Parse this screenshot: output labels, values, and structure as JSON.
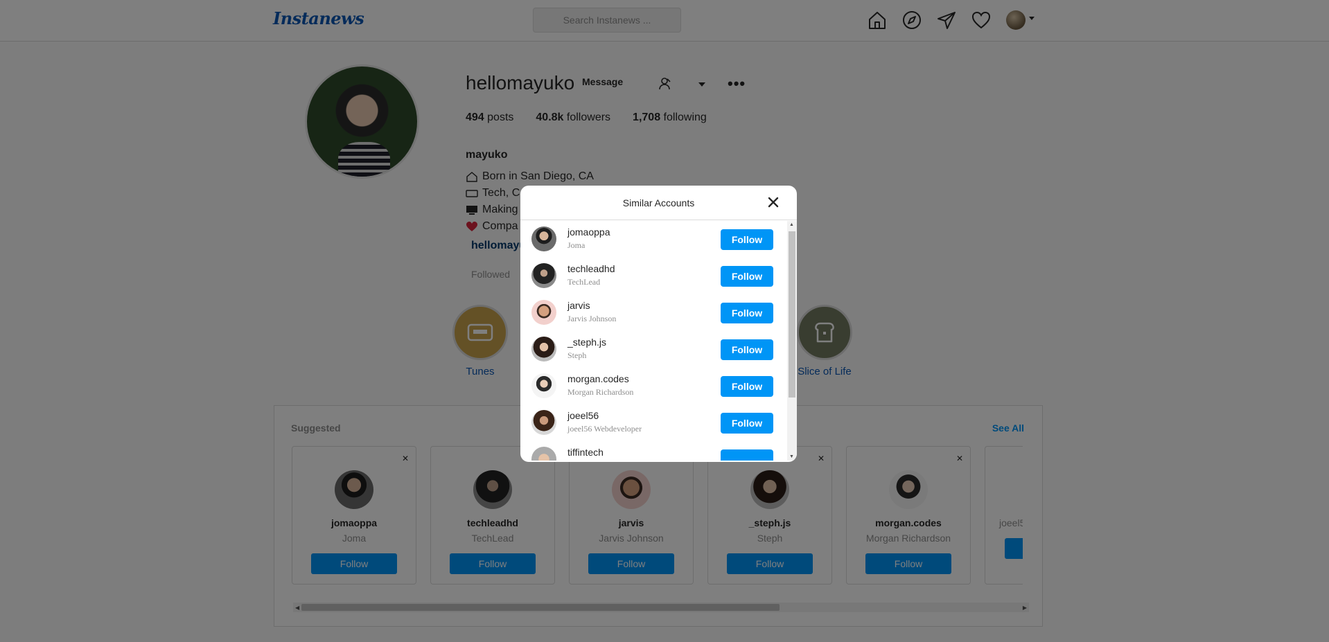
{
  "header": {
    "logo": "Instanews",
    "search_placeholder": "Search Instanews ...",
    "icons": [
      "home-icon",
      "explore-icon",
      "direct-icon",
      "heart-icon"
    ]
  },
  "profile": {
    "username": "hellomayuko",
    "message_label": "Message",
    "more_label": "•••",
    "stats": {
      "posts_count": "494",
      "posts_label": "posts",
      "followers_count": "40.8k",
      "followers_label": "followers",
      "following_count": "1,708",
      "following_label": "following"
    },
    "fullname": "mayuko",
    "bio": [
      "Born in San Diego, CA",
      "Tech, C",
      "Making",
      "Compa"
    ],
    "link": "hellomayu",
    "followed_by": "Followed"
  },
  "highlights": [
    {
      "label": "Tunes",
      "color": "#c8a24c"
    },
    {
      "label": "Slice of Life",
      "color": "#737a61"
    }
  ],
  "suggested": {
    "title": "Suggested",
    "see_all": "See All",
    "cards": [
      {
        "username": "jomaoppa",
        "name": "Joma",
        "follow": "Follow"
      },
      {
        "username": "techleadhd",
        "name": "TechLead",
        "follow": "Follow"
      },
      {
        "username": "jarvis",
        "name": "Jarvis Johnson",
        "follow": "Follow"
      },
      {
        "username": "_steph.js",
        "name": "Steph",
        "follow": "Follow"
      },
      {
        "username": "morgan.codes",
        "name": "Morgan Richardson",
        "follow": "Follow"
      },
      {
        "username": "",
        "name": "joeel5",
        "follow": ""
      }
    ]
  },
  "modal": {
    "title": "Similar Accounts",
    "accounts": [
      {
        "username": "jomaoppa",
        "name": "Joma",
        "follow": "Follow"
      },
      {
        "username": "techleadhd",
        "name": "TechLead",
        "follow": "Follow"
      },
      {
        "username": "jarvis",
        "name": "Jarvis Johnson",
        "follow": "Follow"
      },
      {
        "username": "_steph.js",
        "name": "Steph",
        "follow": "Follow"
      },
      {
        "username": "morgan.codes",
        "name": "Morgan Richardson",
        "follow": "Follow"
      },
      {
        "username": "joeel56",
        "name": "joeel56 Webdeveloper",
        "follow": "Follow"
      },
      {
        "username": "tiffintech",
        "name": "",
        "follow": ""
      }
    ]
  },
  "colors": {
    "accent": "#0095f6",
    "logo": "#0a57b5"
  }
}
